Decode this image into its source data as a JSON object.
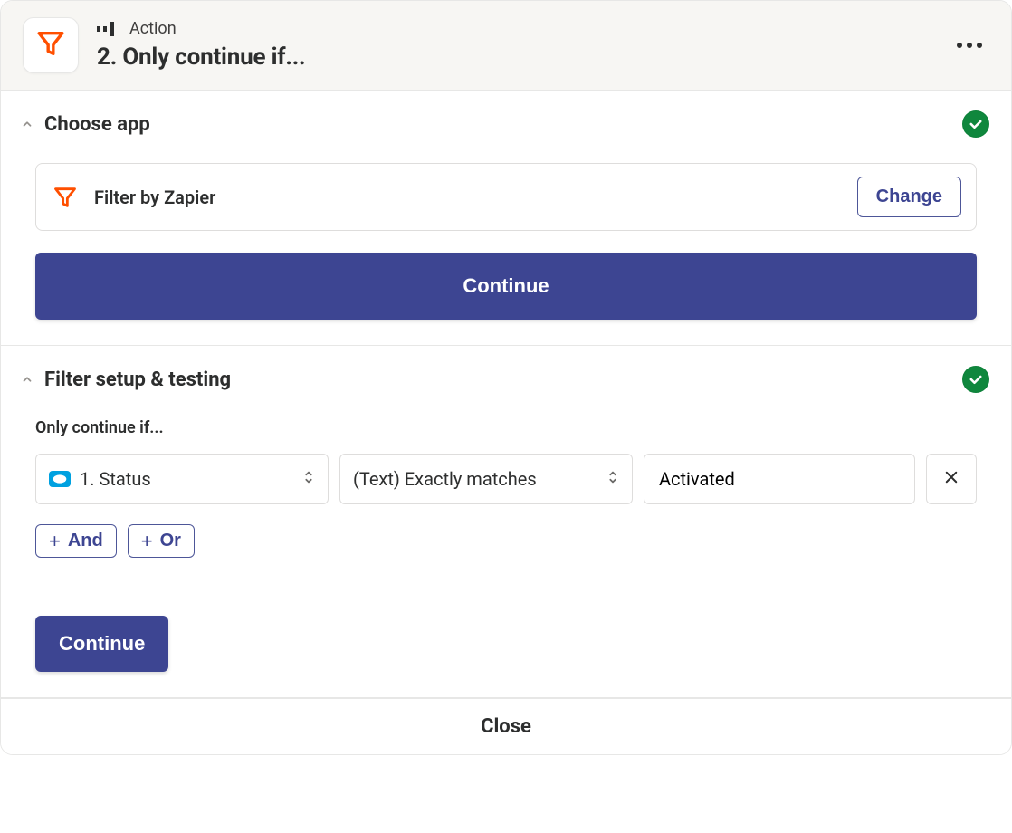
{
  "header": {
    "kicker": "Action",
    "title": "2. Only continue if..."
  },
  "sections": {
    "chooseApp": {
      "title": "Choose app",
      "appName": "Filter by Zapier",
      "changeLabel": "Change",
      "continueLabel": "Continue"
    },
    "filterSetup": {
      "title": "Filter setup & testing",
      "fieldLabel": "Only continue if...",
      "rule": {
        "field": "1. Status",
        "condition": "(Text) Exactly matches",
        "value": "Activated"
      },
      "andLabel": "And",
      "orLabel": "Or",
      "continueLabel": "Continue"
    }
  },
  "footer": {
    "closeLabel": "Close"
  }
}
